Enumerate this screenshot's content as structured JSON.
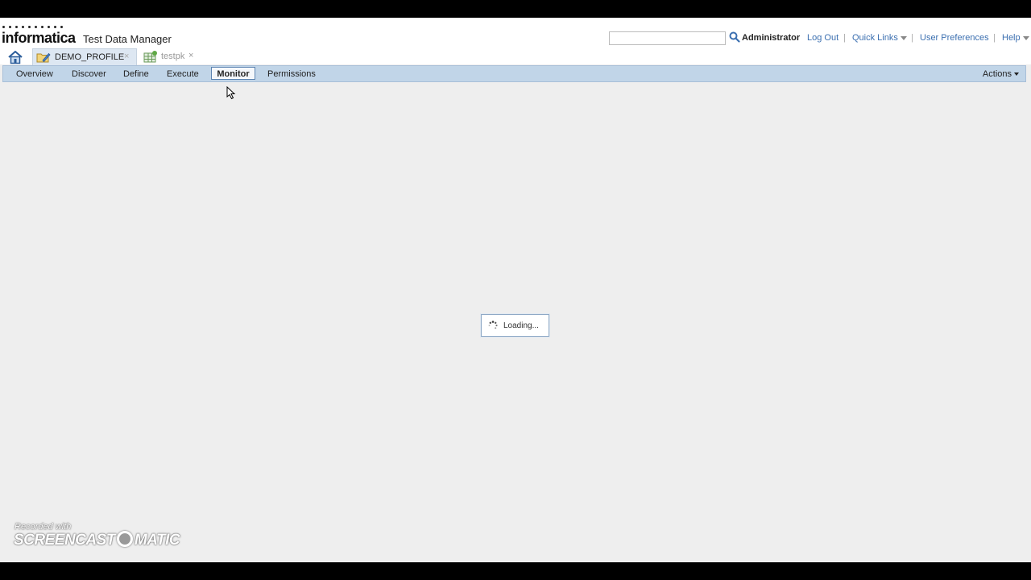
{
  "header": {
    "logo": "informatica",
    "product": "Test Data Manager",
    "search": {
      "value": "",
      "placeholder": ""
    },
    "user": "Administrator",
    "links": {
      "logout": "Log Out",
      "quick_links": "Quick Links",
      "user_preferences": "User Preferences",
      "help": "Help"
    },
    "separator": "|"
  },
  "tabs": [
    {
      "label": "DEMO_PROFILE",
      "close": "×"
    },
    {
      "label": "testpk",
      "close": "×"
    }
  ],
  "subnav": {
    "items": [
      "Overview",
      "Discover",
      "Define",
      "Execute",
      "Monitor",
      "Permissions"
    ],
    "active": "Monitor",
    "actions": "Actions"
  },
  "loading": {
    "text": "Loading..."
  },
  "watermark": {
    "top": "Recorded with",
    "brand_left": "SCREENCAST",
    "brand_right": "MATIC"
  },
  "colors": {
    "link": "#3b6fb0",
    "subnav_bg": "#c1d5e8",
    "page_bg": "#eeeeee"
  }
}
